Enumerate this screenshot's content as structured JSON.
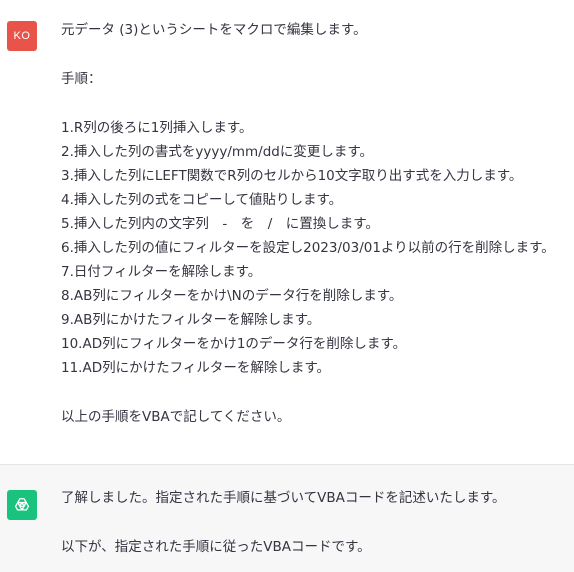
{
  "user": {
    "avatar_initials": "KO",
    "avatar_color": "#e8544a",
    "lines": [
      "元データ (3)というシートをマクロで編集します。",
      "手順：",
      "1.R列の後ろに1列挿入します。",
      "2.挿入した列の書式をyyyy/mm/ddに変更します。",
      "3.挿入した列にLEFT関数でR列のセルから10文字取り出す式を入力します。",
      "4.挿入した列の式をコピーして値貼りします。",
      "5.挿入した列内の文字列　-　を　/　に置換します。",
      "6.挿入した列の値にフィルターを設定し2023/03/01より以前の行を削除します。",
      "7.日付フィルターを解除します。",
      "8.AB列にフィルターをかけ\\Nのデータ行を削除します。",
      "9.AB列にかけたフィルターを解除します。",
      "10.AD列にフィルターをかけ1のデータ行を削除します。",
      "11.AD列にかけたフィルターを解除します。",
      "以上の手順をVBAで記してください。"
    ]
  },
  "assistant": {
    "avatar_icon": "openai-logo-icon",
    "avatar_color": "#19c37d",
    "lines": [
      "了解しました。指定された手順に基づいてVBAコードを記述いたします。",
      "以下が、指定された手順に従ったVBAコードです。"
    ]
  }
}
